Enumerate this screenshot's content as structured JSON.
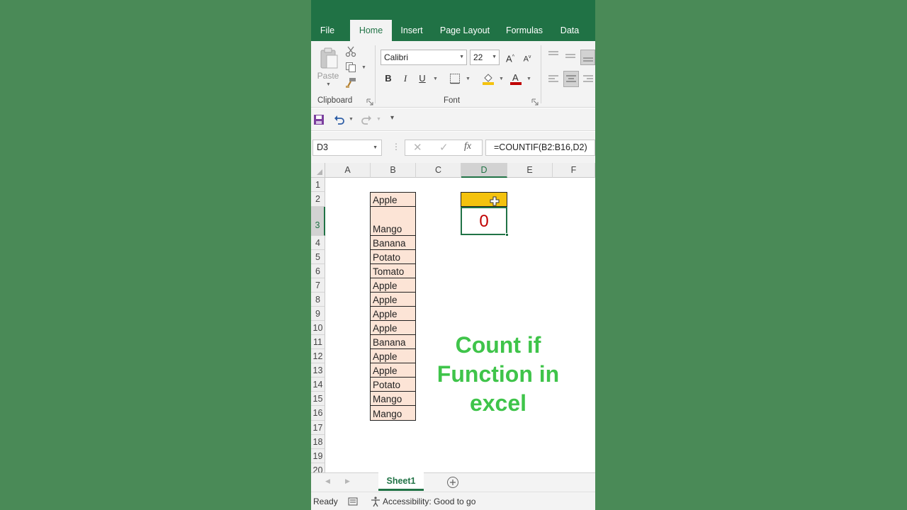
{
  "tabs": [
    "File",
    "Home",
    "Insert",
    "Page Layout",
    "Formulas",
    "Data"
  ],
  "ribbon": {
    "clipboard": {
      "paste_label": "Paste",
      "group_label": "Clipboard"
    },
    "font": {
      "name": "Calibri",
      "size": "22",
      "bold": "B",
      "italic": "I",
      "underline": "U",
      "group_label": "Font"
    }
  },
  "namebox": "D3",
  "formula": "=COUNTIF(B2:B16,D2)",
  "columns": [
    "A",
    "B",
    "C",
    "D",
    "E",
    "F"
  ],
  "selected_column": "D",
  "rows": [
    "1",
    "2",
    "3",
    "4",
    "5",
    "6",
    "7",
    "8",
    "9",
    "10",
    "11",
    "12",
    "13",
    "14",
    "15",
    "16",
    "17",
    "18",
    "19",
    "20"
  ],
  "selected_row": "3",
  "fruits": [
    "Apple",
    "Mango",
    "Banana",
    "Potato",
    "Tomato",
    "Apple",
    "Apple",
    "Apple",
    "Apple",
    "Banana",
    "Apple",
    "Apple",
    "Potato",
    "Mango",
    "Mango"
  ],
  "d3_value": "0",
  "caption": [
    "Count if",
    "Function in",
    "excel"
  ],
  "sheet_tab": "Sheet1",
  "status": {
    "ready": "Ready",
    "accessibility": "Accessibility: Good to go"
  },
  "colors": {
    "excel_green": "#217346",
    "background": "#4a8a57",
    "fill_peach": "#fce4d6",
    "fill_yellow": "#f4c20e",
    "result_red": "#c00000",
    "caption_green": "#3fc44a"
  }
}
